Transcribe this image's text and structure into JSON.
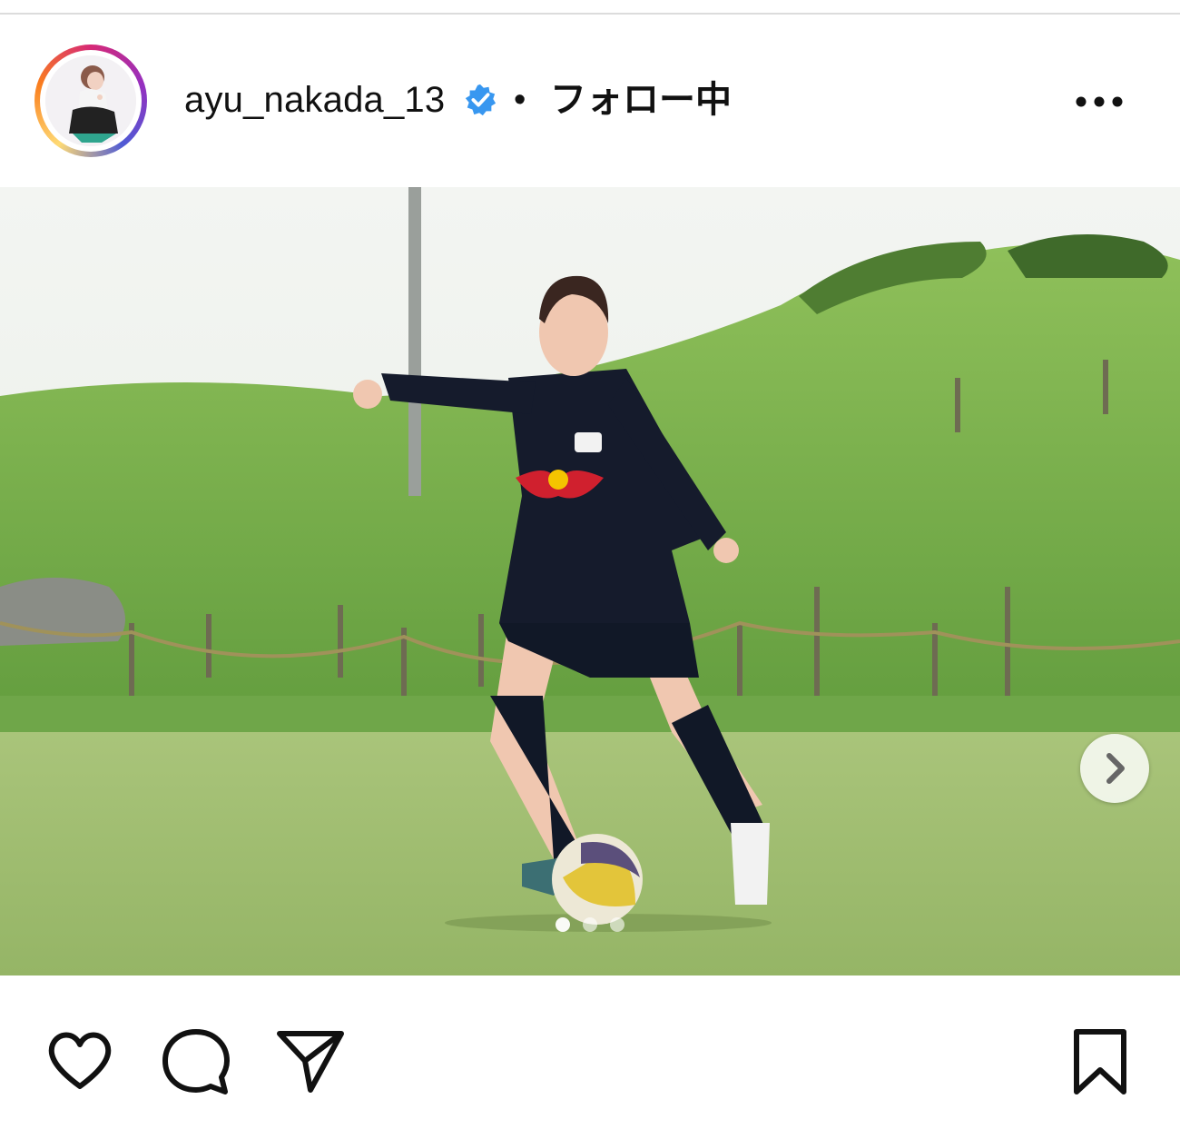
{
  "post": {
    "username": "ayu_nakada_13",
    "separator": "•",
    "follow_status": "フォロー中"
  },
  "icons": {
    "avatar": "profile-photo",
    "verified": "verified-badge-icon",
    "more": "more-options-icon",
    "next": "chevron-right-icon",
    "like": "heart-icon",
    "comment": "comment-bubble-icon",
    "share": "paper-plane-icon",
    "save": "bookmark-icon"
  },
  "carousel": {
    "slides": 3,
    "active_index": 0
  },
  "colors": {
    "verified": "#3897f0",
    "text": "#111111",
    "ring_start": "#d62976",
    "ring_end": "#feda75"
  }
}
